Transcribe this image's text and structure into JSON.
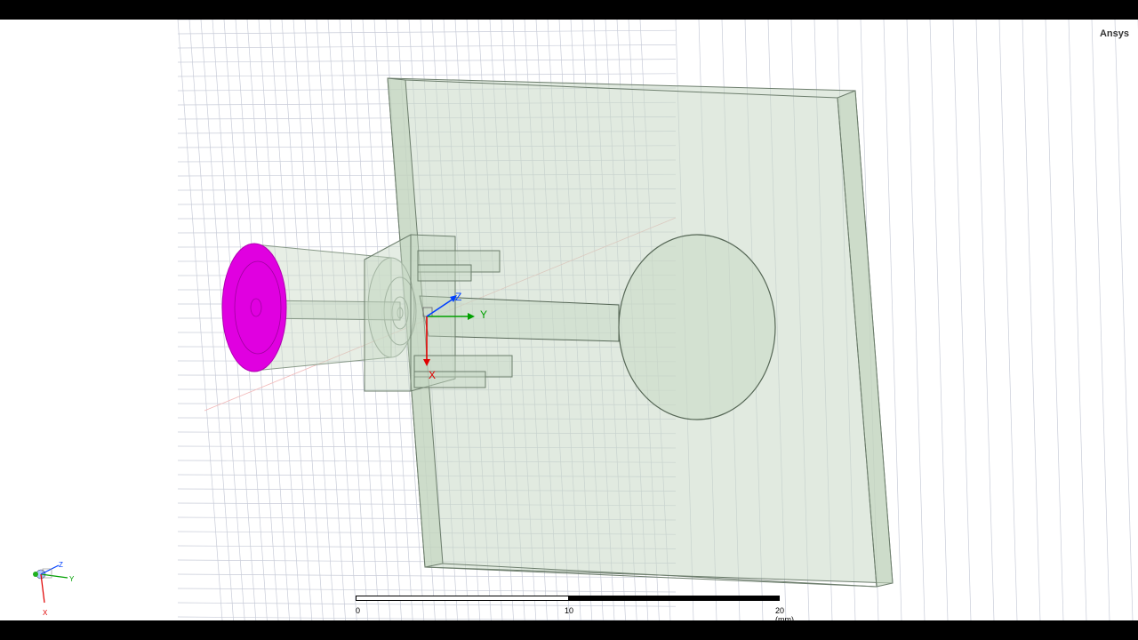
{
  "app": {
    "brand": "Ansys"
  },
  "coordinate_system": {
    "x_label": "X",
    "y_label": "Y",
    "z_label": "Z"
  },
  "triad": {
    "x_label": "X",
    "y_label": "Y",
    "z_label": "Z"
  },
  "scale_bar": {
    "tick_0": "0",
    "tick_10": "10",
    "tick_20": "20 (mm)"
  },
  "colors": {
    "grid": "#c8ccd8",
    "solid_fill": "#c5d6c3",
    "port_face": "#e000e0",
    "axis_x": "#e00000",
    "axis_y": "#00a000",
    "axis_z": "#0040ff"
  }
}
